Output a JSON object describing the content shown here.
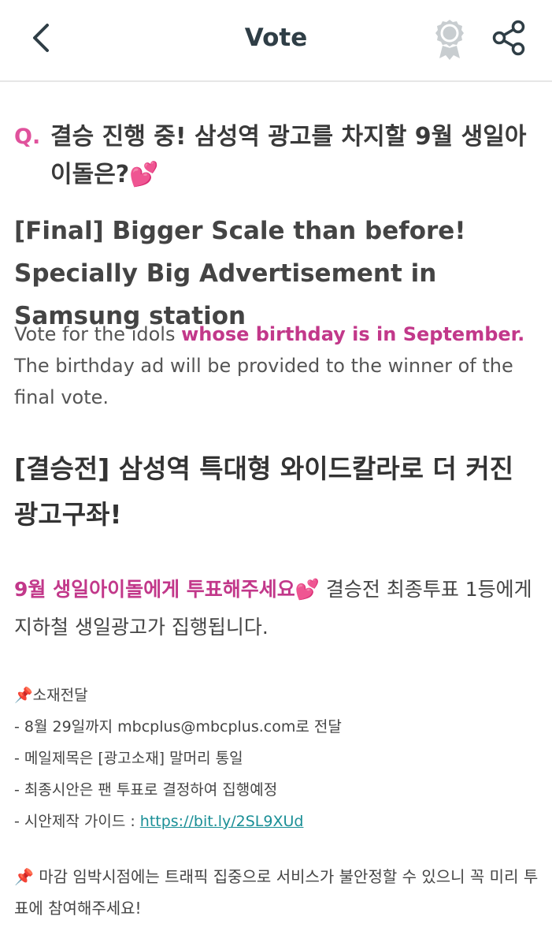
{
  "header": {
    "title": "Vote",
    "back_icon": "chevron-left-icon",
    "badge_icon": "award-badge-icon",
    "share_icon": "share-icon"
  },
  "question": {
    "mark": "Q.",
    "text_ko": "결승 진행 중! 삼성역 광고를 차지할 9월 생일아이돌은?💕",
    "title_en": "[Final] Bigger Scale than before! Specially Big Advertisement in Samsung station"
  },
  "description_en": {
    "before": "Vote for the idols ",
    "highlight": "whose birthday is in September.",
    "after": " The birthday ad will be provided to the winner of the final vote."
  },
  "title_ko": "[결승전] 삼성역 특대형 와이드칼라로 더 커진 광고구좌!",
  "description_ko": {
    "highlight": "9월 생일아이돌에게 투표해주세요💕",
    "after": " 결승전 최종투표 1등에게 지하철 생일광고가 집행됩니다."
  },
  "notes": {
    "heading": "📌소재전달",
    "items": [
      "- 8월 29일까지 mbcplus@mbcplus.com로 전달",
      "- 메일제목은 [광고소재] 말머리 통일",
      "- 최종시안은 팬 투표로 결정하여 집행예정"
    ],
    "guide_label": "- 시안제작 가이드 : ",
    "guide_link": "https://bit.ly/2SL9XUd"
  },
  "notice": "📌 마감 임박시점에는 트래픽 집중으로 서비스가 불안정할 수 있으니 꼭 미리 투표에 참여해주세요!",
  "colors": {
    "accent_pink": "#e0529c",
    "highlight_magenta": "#c2388a",
    "link_teal": "#1a8f96",
    "header_text": "#2f3e46"
  }
}
